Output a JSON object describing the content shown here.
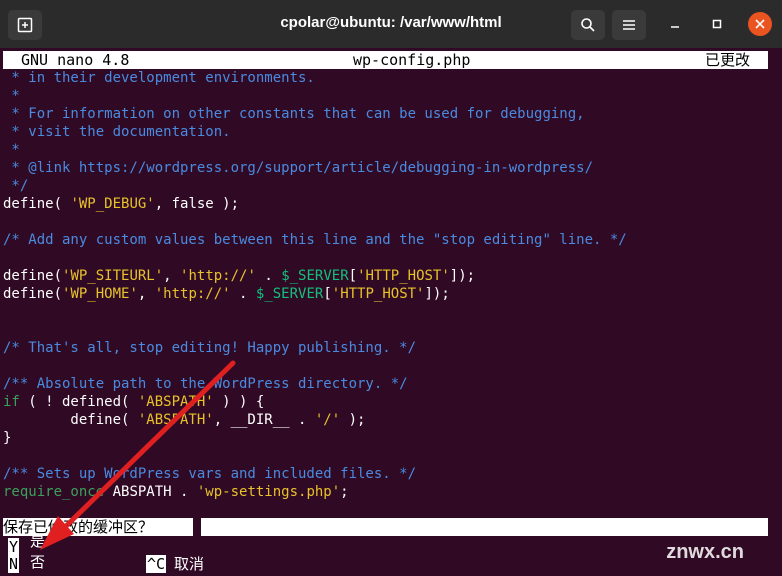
{
  "window": {
    "title": "cpolar@ubuntu: /var/www/html"
  },
  "nano": {
    "version": "GNU nano 4.8",
    "filename": "wp-config.php",
    "modified": "已更改"
  },
  "editor_lines": [
    [
      {
        "c": "cm",
        "t": " * in their development environments."
      }
    ],
    [
      {
        "c": "cm",
        "t": " *"
      }
    ],
    [
      {
        "c": "cm",
        "t": " * For information on other constants that can be used for debugging,"
      }
    ],
    [
      {
        "c": "cm",
        "t": " * visit the documentation."
      }
    ],
    [
      {
        "c": "cm",
        "t": " *"
      }
    ],
    [
      {
        "c": "cm",
        "t": " * @link https://wordpress.org/support/article/debugging-in-wordpress/"
      }
    ],
    [
      {
        "c": "cm",
        "t": " */"
      }
    ],
    [
      {
        "c": "df",
        "t": "define( "
      },
      {
        "c": "st",
        "t": "'WP_DEBUG'"
      },
      {
        "c": "df",
        "t": ", false );"
      }
    ],
    [],
    [
      {
        "c": "cm",
        "t": "/* Add any custom values between this line and the \"stop editing\" line. */"
      }
    ],
    [],
    [
      {
        "c": "df",
        "t": "define("
      },
      {
        "c": "st",
        "t": "'WP_SITEURL'"
      },
      {
        "c": "df",
        "t": ", "
      },
      {
        "c": "st",
        "t": "'http://'"
      },
      {
        "c": "df",
        "t": " . "
      },
      {
        "c": "vr",
        "t": "$_SERVER"
      },
      {
        "c": "df",
        "t": "["
      },
      {
        "c": "st",
        "t": "'HTTP_HOST'"
      },
      {
        "c": "df",
        "t": "]);"
      }
    ],
    [
      {
        "c": "df",
        "t": "define("
      },
      {
        "c": "st",
        "t": "'WP_HOME'"
      },
      {
        "c": "df",
        "t": ", "
      },
      {
        "c": "st",
        "t": "'http://'"
      },
      {
        "c": "df",
        "t": " . "
      },
      {
        "c": "vr",
        "t": "$_SERVER"
      },
      {
        "c": "df",
        "t": "["
      },
      {
        "c": "st",
        "t": "'HTTP_HOST'"
      },
      {
        "c": "df",
        "t": "]);"
      }
    ],
    [],
    [],
    [
      {
        "c": "cm",
        "t": "/* That's all, stop editing! Happy publishing. */"
      }
    ],
    [],
    [
      {
        "c": "cm",
        "t": "/** Absolute path to the WordPress directory. */"
      }
    ],
    [
      {
        "c": "kw",
        "t": "if"
      },
      {
        "c": "df",
        "t": " ( ! defined( "
      },
      {
        "c": "st",
        "t": "'ABSPATH'"
      },
      {
        "c": "df",
        "t": " ) ) {"
      }
    ],
    [
      {
        "c": "df",
        "t": "        define( "
      },
      {
        "c": "st",
        "t": "'ABSPATH'"
      },
      {
        "c": "df",
        "t": ", __DIR__ . "
      },
      {
        "c": "st",
        "t": "'/'"
      },
      {
        "c": "df",
        "t": " );"
      }
    ],
    [
      {
        "c": "df",
        "t": "}"
      }
    ],
    [],
    [
      {
        "c": "cm",
        "t": "/** Sets up WordPress vars and included files. */"
      }
    ],
    [
      {
        "c": "kw",
        "t": "require_once"
      },
      {
        "c": "df",
        "t": " ABSPATH . "
      },
      {
        "c": "st",
        "t": "'wp-settings.php'"
      },
      {
        "c": "df",
        "t": ";"
      }
    ]
  ],
  "prompt": {
    "question": "保存已修改的缓冲区？",
    "yes_key": "Y",
    "yes_label": "是",
    "no_key": "N",
    "no_label": "否",
    "cancel_key": "^C",
    "cancel_label": "取消"
  },
  "watermark": "znwx.cn",
  "colors": {
    "terminal_bg": "#300a24",
    "comment": "#4a8ae0",
    "string": "#e7c22a",
    "variable": "#12c07d",
    "keyword": "#3aa05a",
    "arrow": "#e02020"
  },
  "icons": [
    "new-tab-icon",
    "search-icon",
    "menu-icon",
    "minimize-icon",
    "maximize-icon",
    "close-icon"
  ]
}
